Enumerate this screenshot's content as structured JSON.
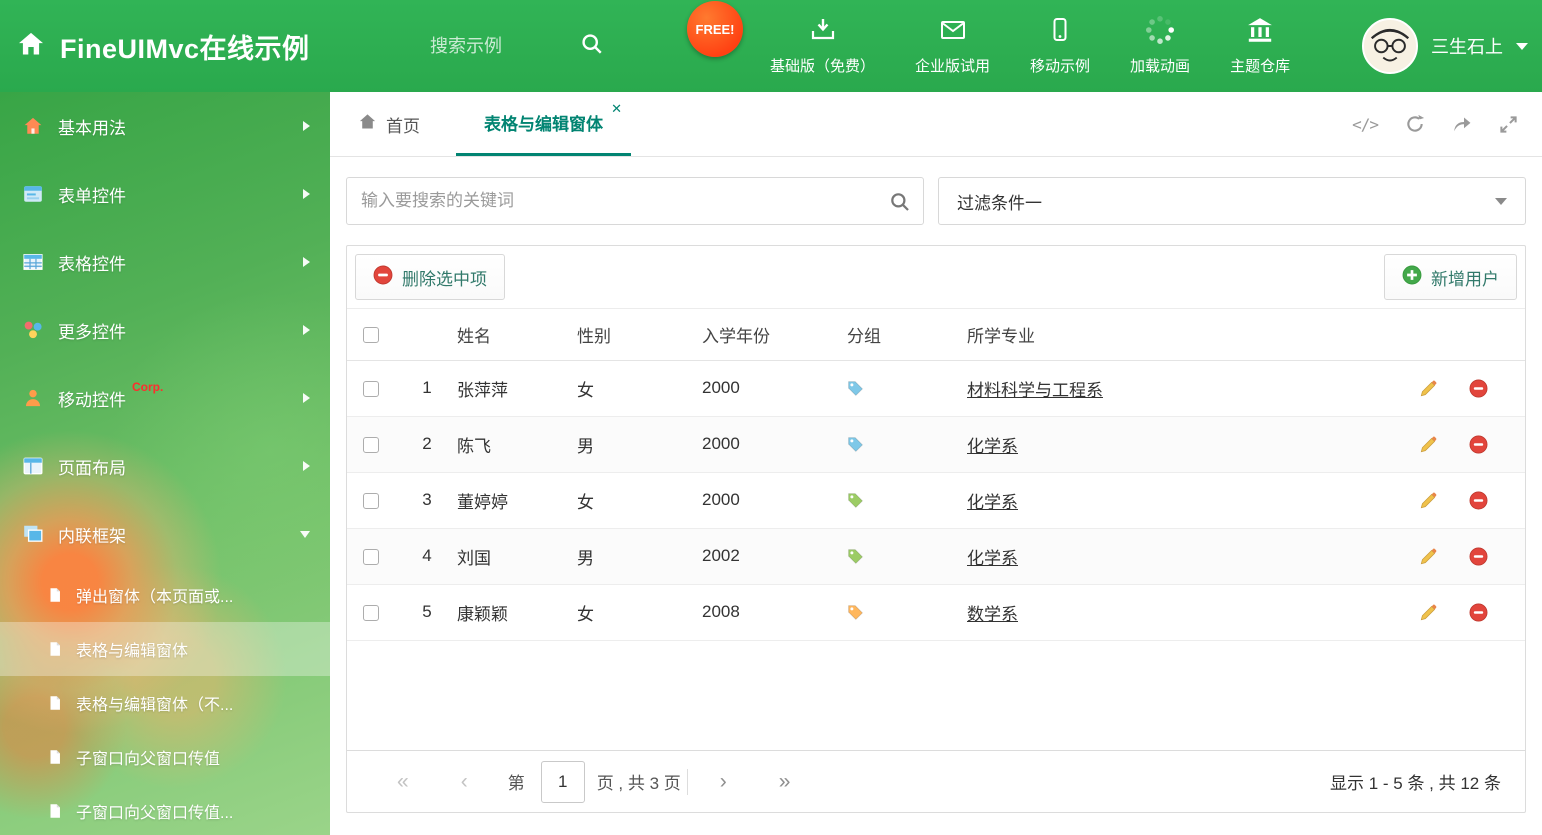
{
  "colors": {
    "header_green": "#2fae52",
    "accent_teal": "#028472",
    "free_badge_bg": "#ff4d12",
    "tag_blue": "#7ec8e8",
    "tag_green": "#9ccc65",
    "tag_orange": "#ffb75d",
    "delete_red": "#e2453c",
    "add_green": "#43a84a"
  },
  "header": {
    "title": "FineUIMvc在线示例",
    "search_placeholder": "搜索示例",
    "free_badge": "FREE!",
    "nav": [
      {
        "label": "基础版（免费）"
      },
      {
        "label": "企业版试用"
      },
      {
        "label": "移动示例"
      },
      {
        "label": "加载动画"
      },
      {
        "label": "主题仓库"
      }
    ],
    "user_name": "三生石上"
  },
  "sidebar": {
    "items": [
      {
        "label": "基本用法"
      },
      {
        "label": "表单控件"
      },
      {
        "label": "表格控件"
      },
      {
        "label": "更多控件"
      },
      {
        "label": "移动控件",
        "badge": "Corp."
      },
      {
        "label": "页面布局"
      },
      {
        "label": "内联框架"
      }
    ],
    "subitems": [
      {
        "label": "弹出窗体（本页面或..."
      },
      {
        "label": "表格与编辑窗体"
      },
      {
        "label": "表格与编辑窗体（不..."
      },
      {
        "label": "子窗口向父窗口传值"
      },
      {
        "label": "子窗口向父窗口传值..."
      }
    ]
  },
  "tabs": {
    "home": "首页",
    "active": "表格与编辑窗体",
    "close_glyph": "✕"
  },
  "tab_actions": {
    "code_glyph": "</>"
  },
  "filter": {
    "search_placeholder": "输入要搜索的关键词",
    "selected": "过滤条件一"
  },
  "toolbar": {
    "delete": "删除选中项",
    "add": "新增用户"
  },
  "table": {
    "headers": {
      "name": "姓名",
      "gender": "性别",
      "year": "入学年份",
      "group": "分组",
      "major": "所学专业"
    },
    "rows": [
      {
        "num": "1",
        "name": "张萍萍",
        "gender": "女",
        "year": "2000",
        "tag": "#7ec8e8",
        "major": "材料科学与工程系"
      },
      {
        "num": "2",
        "name": "陈飞",
        "gender": "男",
        "year": "2000",
        "tag": "#7ec8e8",
        "major": "化学系"
      },
      {
        "num": "3",
        "name": "董婷婷",
        "gender": "女",
        "year": "2000",
        "tag": "#9ccc65",
        "major": "化学系"
      },
      {
        "num": "4",
        "name": "刘国",
        "gender": "男",
        "year": "2002",
        "tag": "#9ccc65",
        "major": "化学系"
      },
      {
        "num": "5",
        "name": "康颖颖",
        "gender": "女",
        "year": "2008",
        "tag": "#ffb75d",
        "major": "数学系"
      }
    ]
  },
  "pagination": {
    "first_glyph": "«",
    "prev_glyph": "‹",
    "prefix": "第",
    "page": "1",
    "suffix": "页 , 共 3 页",
    "next_glyph": "›",
    "last_glyph": "»",
    "summary": "显示 1 - 5 条 , 共 12 条"
  }
}
